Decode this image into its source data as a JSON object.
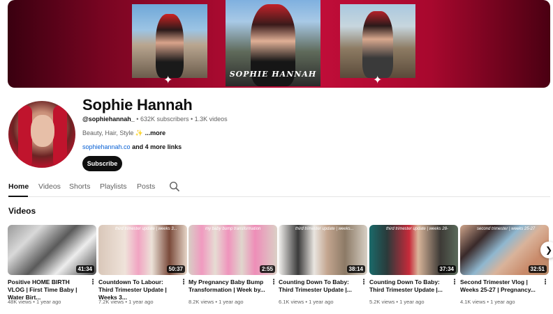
{
  "banner": {
    "name_text": "SOPHIE HANNAH"
  },
  "channel": {
    "name": "Sophie Hannah",
    "handle": "@sophiehannah_",
    "subscribers": "632K subscribers",
    "videos_count": "1.3K videos",
    "separator": " • ",
    "description": "Beauty, Hair, Style ✨ ",
    "more_label": "...more",
    "link": "sophiehannah.co",
    "more_links": " and 4 more links",
    "subscribe_label": "Subscribe"
  },
  "tabs": [
    {
      "label": "Home",
      "active": true
    },
    {
      "label": "Videos",
      "active": false
    },
    {
      "label": "Shorts",
      "active": false
    },
    {
      "label": "Playlists",
      "active": false
    },
    {
      "label": "Posts",
      "active": false
    }
  ],
  "tab_search_icon": "search-icon",
  "section_title": "Videos",
  "videos": [
    {
      "title": "Positive HOME BIRTH VLOG | First Time Baby | Water Birt...",
      "views": "48K views",
      "age": "1 year ago",
      "duration": "41:34",
      "overlay": ""
    },
    {
      "title": "Countdown To Labour: Third Trimester Update | Weeks 3...",
      "views": "7.2K views",
      "age": "1 year ago",
      "duration": "50:37",
      "overlay": "third trimester update | weeks 3..."
    },
    {
      "title": "My Pregnancy Baby Bump Transformation | Week by...",
      "views": "8.2K views",
      "age": "1 year ago",
      "duration": "2:55",
      "overlay": "my baby bump transformation"
    },
    {
      "title": "Counting Down To Baby: Third Trimester Update |...",
      "views": "6.1K views",
      "age": "1 year ago",
      "duration": "38:14",
      "overlay": "third trimester update | weeks..."
    },
    {
      "title": "Counting Down To Baby: Third Trimester Update |...",
      "views": "5.2K views",
      "age": "1 year ago",
      "duration": "37:34",
      "overlay": "third trimester update | weeks 28-"
    },
    {
      "title": "Second Trimester Vlog | Weeks 25-27 | Pregnancy...",
      "views": "4.1K views",
      "age": "1 year ago",
      "duration": "32:51",
      "overlay": "second trimester | weeks 25-27"
    }
  ],
  "view_separator": " • ",
  "colors": {
    "banner_accent": "#c30e3a",
    "link": "#065fd4",
    "subscribe_bg": "#0f0f0f"
  }
}
